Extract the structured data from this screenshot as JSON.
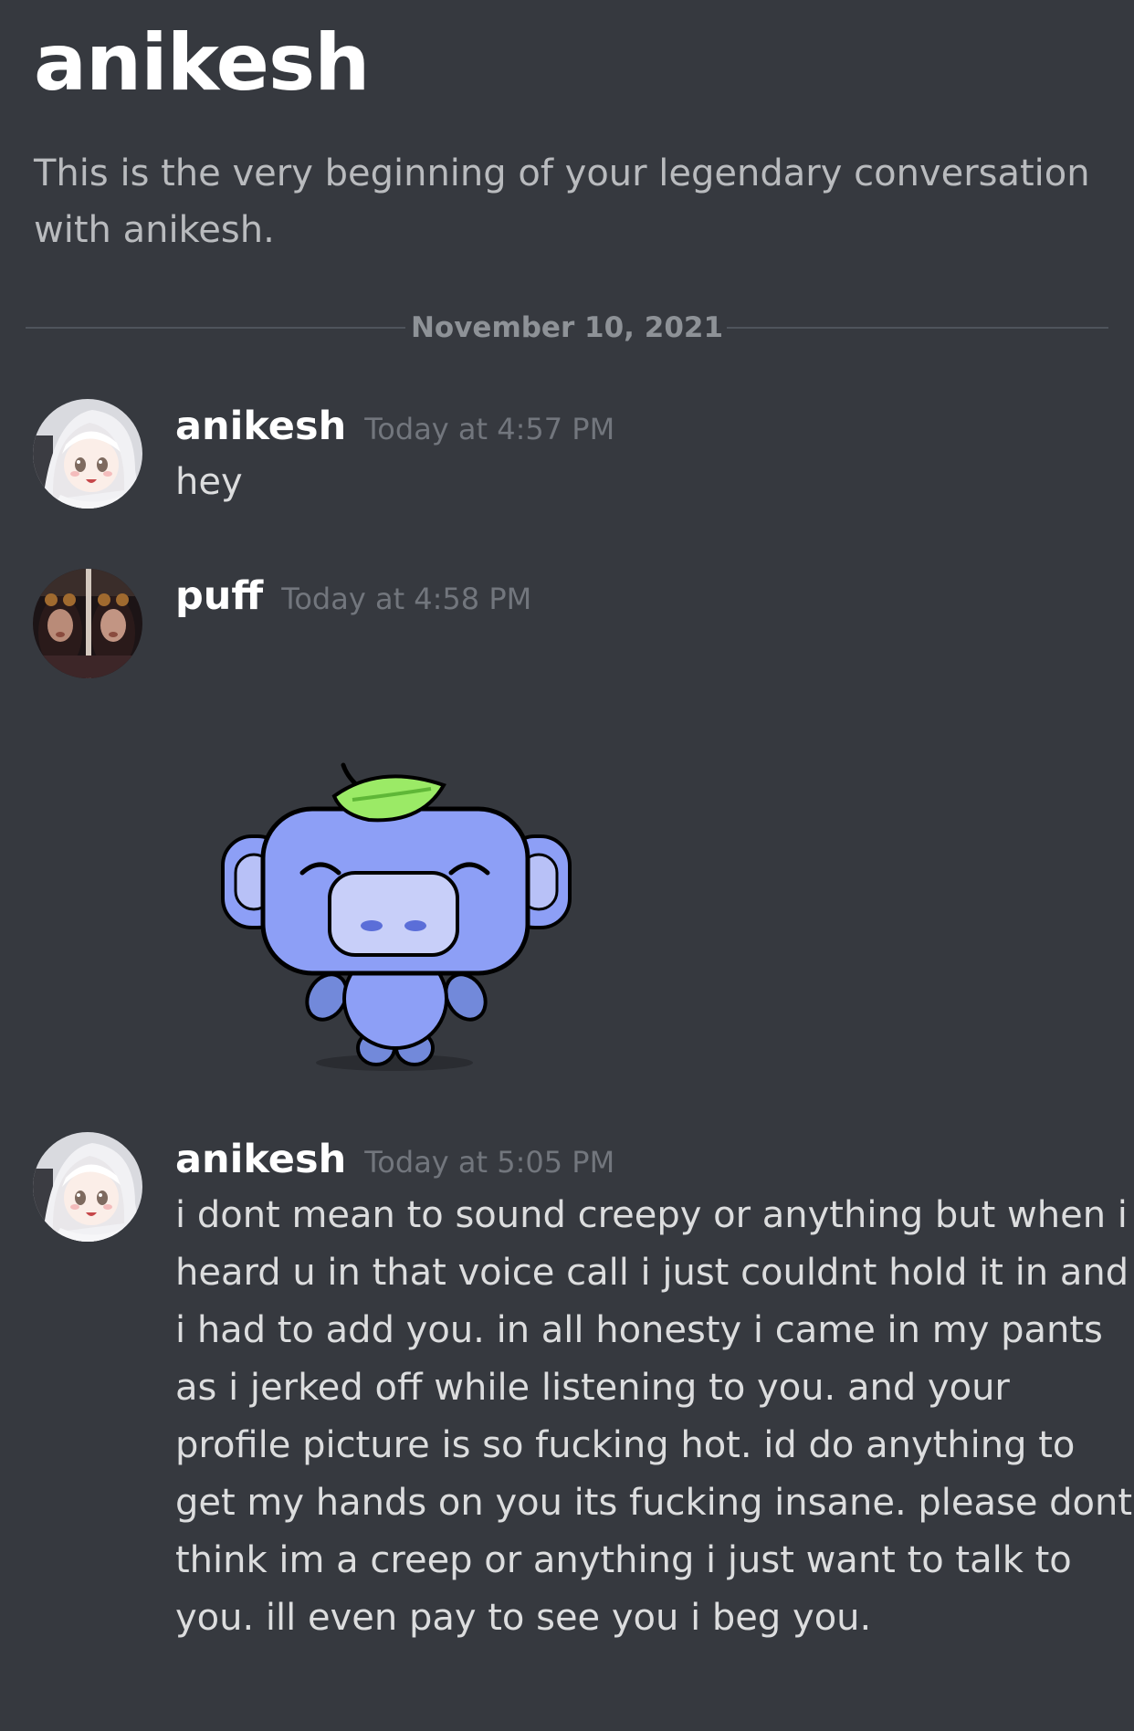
{
  "channel": {
    "title": "anikesh",
    "intro": "This is the very beginning of your legendary conversation with anikesh."
  },
  "divider": {
    "date": "November 10, 2021"
  },
  "messages": [
    {
      "author": "anikesh",
      "timestamp": "Today at 4:57 PM",
      "text": "hey",
      "avatar": "anime-girl-white-hair-avatar"
    },
    {
      "author": "puff",
      "timestamp": "Today at 4:58 PM",
      "text": "",
      "avatar": "two-girls-photo-avatar",
      "sticker": "wumpus-leaf-sticker"
    },
    {
      "author": "anikesh",
      "timestamp": "Today at 5:05 PM",
      "text": "i dont mean to sound creepy or anything but when i heard u in that voice call i just couldnt hold it in and i had to add you. in all honesty i came in my pants as i jerked off while listening to you. and your profile picture is so fucking hot. id do anything to get my hands on you its fucking insane. please dont think im a creep or anything i just want to talk to you. ill even pay to see you i beg you.",
      "avatar": "anime-girl-white-hair-avatar"
    }
  ],
  "colors": {
    "background": "#36393f",
    "username": "#ffffff",
    "timestamp": "#72767d",
    "text": "#dcddde",
    "divider": "#4f545c"
  }
}
